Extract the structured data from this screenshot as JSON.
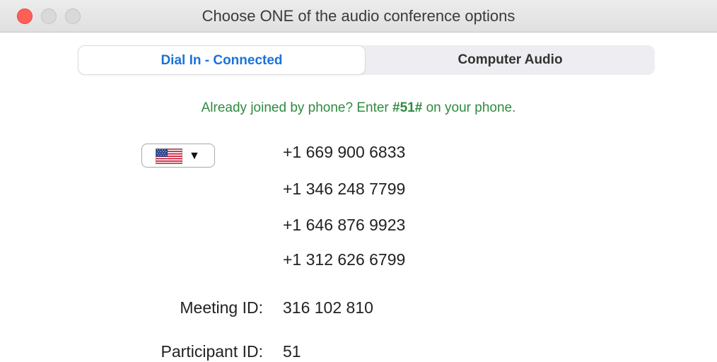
{
  "window": {
    "title": "Choose ONE of the audio conference options"
  },
  "tabs": [
    {
      "label": "Dial In - Connected",
      "active": true
    },
    {
      "label": "Computer Audio",
      "active": false
    }
  ],
  "hint": {
    "prefix": "Already joined by phone? Enter ",
    "code": "#51#",
    "suffix": " on your phone."
  },
  "country_select": {
    "selected": "us-flag-icon",
    "caret": "▼"
  },
  "phone_numbers": [
    "+1 669 900 6833",
    "+1 346 248 7799",
    "+1 646 876 9923",
    "+1 312 626 6799"
  ],
  "meeting": {
    "id_label": "Meeting ID:",
    "id_value": "316 102 810",
    "participant_label": "Participant ID:",
    "participant_value": "51"
  },
  "colors": {
    "accent": "#1a73d9",
    "hint_green": "#2f8a3f",
    "close_red": "#fe5f57"
  }
}
